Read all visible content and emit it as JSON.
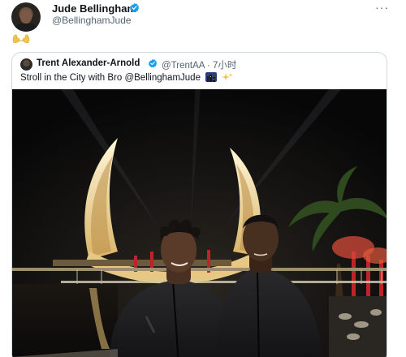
{
  "author": {
    "name": "Jude Bellingham",
    "handle": "@BellinghamJude",
    "avatar_icon": "profile-avatar",
    "verified_icon": "verified-badge-icon",
    "more_label": "···"
  },
  "body": {
    "emoji_icon": "flexed-arms-icon"
  },
  "quoted": {
    "name": "Trent Alexander-Arnold",
    "handle_time": "@TrentAA · 7小时",
    "text": "Stroll in the City with Bro @BellinghamJude",
    "emoji_icons": [
      "night-city-icon",
      "sparkles-icon"
    ]
  },
  "colors": {
    "accent": "#1d9bf0",
    "secondary_text": "#536471",
    "border": "#cfd9de"
  }
}
